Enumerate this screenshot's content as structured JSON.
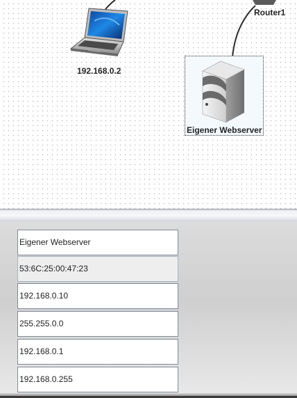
{
  "network_view": {
    "nodes": [
      {
        "label": "192.168.0.2",
        "icon": "laptop-icon"
      },
      {
        "label": "Router1",
        "icon": "router-icon"
      },
      {
        "label": "Eigener Webserver",
        "icon": "server-icon",
        "selected": true
      }
    ]
  },
  "properties_panel": {
    "fields": [
      {
        "value": "Eigener Webserver",
        "editable": true
      },
      {
        "value": "53:6C:25:00:47:23",
        "editable": false
      },
      {
        "value": "192.168.0.10",
        "editable": true
      },
      {
        "value": "255.255.0.0",
        "editable": true
      },
      {
        "value": "192.168.0.1",
        "editable": true
      },
      {
        "value": "192.168.0.255",
        "editable": true
      }
    ]
  },
  "colors": {
    "laptop_screen": "#1565c0",
    "selection_background": "#f4f9fd",
    "panel_background": "#d6d6d6"
  }
}
